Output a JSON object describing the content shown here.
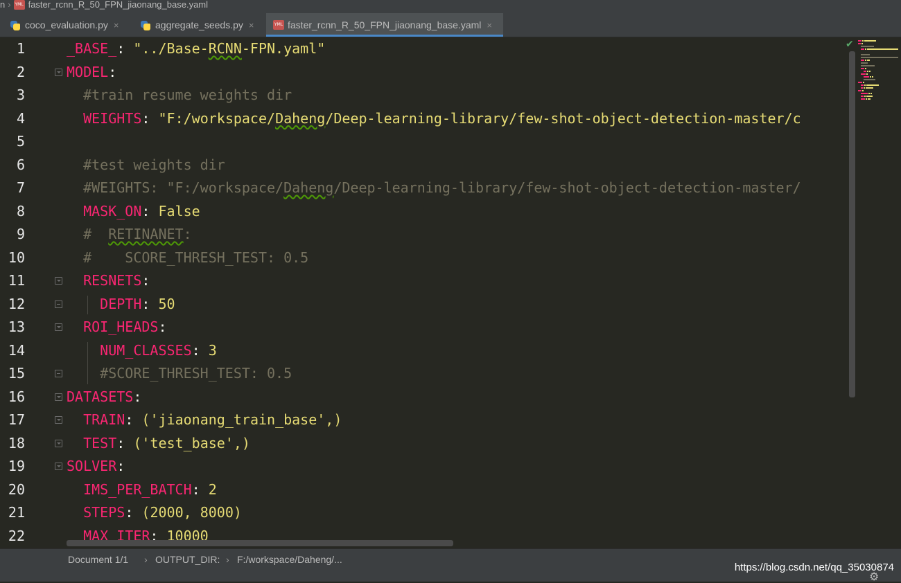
{
  "breadcrumb": {
    "prefix": "n",
    "file": "faster_rcnn_R_50_FPN_jiaonang_base.yaml"
  },
  "tabs": [
    {
      "label": "coco_evaluation.py",
      "icon": "python-file-icon",
      "active": false
    },
    {
      "label": "aggregate_seeds.py",
      "icon": "python-file-icon",
      "active": false
    },
    {
      "label": "faster_rcnn_R_50_FPN_jiaonang_base.yaml",
      "icon": "yaml-file-icon",
      "active": true
    }
  ],
  "close_glyph": "×",
  "editor": {
    "lines": [
      {
        "n": "1",
        "indent": "",
        "parts": [
          [
            "key",
            "_BASE_"
          ],
          [
            "punc",
            ": "
          ],
          [
            "str",
            "\"../Base-RCNN-FPN.yaml\""
          ]
        ]
      },
      {
        "n": "2",
        "indent": "",
        "parts": [
          [
            "key",
            "MODEL"
          ],
          [
            "punc",
            ":"
          ]
        ]
      },
      {
        "n": "3",
        "indent": "  ",
        "parts": [
          [
            "cmt",
            "#train resume weights dir"
          ]
        ]
      },
      {
        "n": "4",
        "indent": "  ",
        "parts": [
          [
            "key",
            "WEIGHTS"
          ],
          [
            "punc",
            ": "
          ],
          [
            "str",
            "\"F:/workspace/Daheng/Deep-learning-library/few-shot-object-detection-master/c"
          ]
        ]
      },
      {
        "n": "5",
        "indent": "",
        "parts": []
      },
      {
        "n": "6",
        "indent": "  ",
        "parts": [
          [
            "cmt",
            "#test weights dir"
          ]
        ]
      },
      {
        "n": "7",
        "indent": "  ",
        "parts": [
          [
            "cmt",
            "#WEIGHTS: \"F:/workspace/Daheng/Deep-learning-library/few-shot-object-detection-master/"
          ]
        ]
      },
      {
        "n": "8",
        "indent": "  ",
        "parts": [
          [
            "key",
            "MASK_ON"
          ],
          [
            "punc",
            ": "
          ],
          [
            "bool",
            "False"
          ]
        ]
      },
      {
        "n": "9",
        "indent": "  ",
        "parts": [
          [
            "cmt",
            "#  RETINANET:"
          ]
        ]
      },
      {
        "n": "10",
        "indent": "  ",
        "parts": [
          [
            "cmt",
            "#    SCORE_THRESH_TEST: 0.5"
          ]
        ]
      },
      {
        "n": "11",
        "indent": "  ",
        "parts": [
          [
            "key",
            "RESNETS"
          ],
          [
            "punc",
            ":"
          ]
        ]
      },
      {
        "n": "12",
        "indent": "    ",
        "parts": [
          [
            "key",
            "DEPTH"
          ],
          [
            "punc",
            ": "
          ],
          [
            "num",
            "50"
          ]
        ]
      },
      {
        "n": "13",
        "indent": "  ",
        "parts": [
          [
            "key",
            "ROI_HEADS"
          ],
          [
            "punc",
            ":"
          ]
        ]
      },
      {
        "n": "14",
        "indent": "    ",
        "parts": [
          [
            "key",
            "NUM_CLASSES"
          ],
          [
            "punc",
            ": "
          ],
          [
            "num",
            "3"
          ]
        ]
      },
      {
        "n": "15",
        "indent": "    ",
        "parts": [
          [
            "cmt",
            "#SCORE_THRESH_TEST: 0.5"
          ]
        ]
      },
      {
        "n": "16",
        "indent": "",
        "parts": [
          [
            "key",
            "DATASETS"
          ],
          [
            "punc",
            ":"
          ]
        ]
      },
      {
        "n": "17",
        "indent": "  ",
        "parts": [
          [
            "key",
            "TRAIN"
          ],
          [
            "punc",
            ": "
          ],
          [
            "str",
            "('jiaonang_train_base',)"
          ]
        ]
      },
      {
        "n": "18",
        "indent": "  ",
        "parts": [
          [
            "key",
            "TEST"
          ],
          [
            "punc",
            ": "
          ],
          [
            "str",
            "('test_base',)"
          ]
        ]
      },
      {
        "n": "19",
        "indent": "",
        "parts": [
          [
            "key",
            "SOLVER"
          ],
          [
            "punc",
            ":"
          ]
        ]
      },
      {
        "n": "20",
        "indent": "  ",
        "parts": [
          [
            "key",
            "IMS_PER_BATCH"
          ],
          [
            "punc",
            ": "
          ],
          [
            "num",
            "2"
          ]
        ]
      },
      {
        "n": "21",
        "indent": "  ",
        "parts": [
          [
            "key",
            "STEPS"
          ],
          [
            "punc",
            ": "
          ],
          [
            "str",
            "(2000, 8000)"
          ]
        ]
      },
      {
        "n": "22",
        "indent": "  ",
        "parts": [
          [
            "key",
            "MAX_ITER"
          ],
          [
            "punc",
            ": "
          ],
          [
            "num",
            "10000"
          ]
        ]
      }
    ]
  },
  "statusbar": {
    "document": "Document 1/1",
    "path_1": "OUTPUT_DIR:",
    "path_2": "F:/workspace/Daheng/..."
  },
  "watermark": "https://blog.csdn.net/qq_35030874",
  "colors": {
    "key": "#f92672",
    "string": "#e6db74",
    "comment": "#75715e",
    "background": "#272822",
    "active_tab_underline": "#4a88c7"
  }
}
